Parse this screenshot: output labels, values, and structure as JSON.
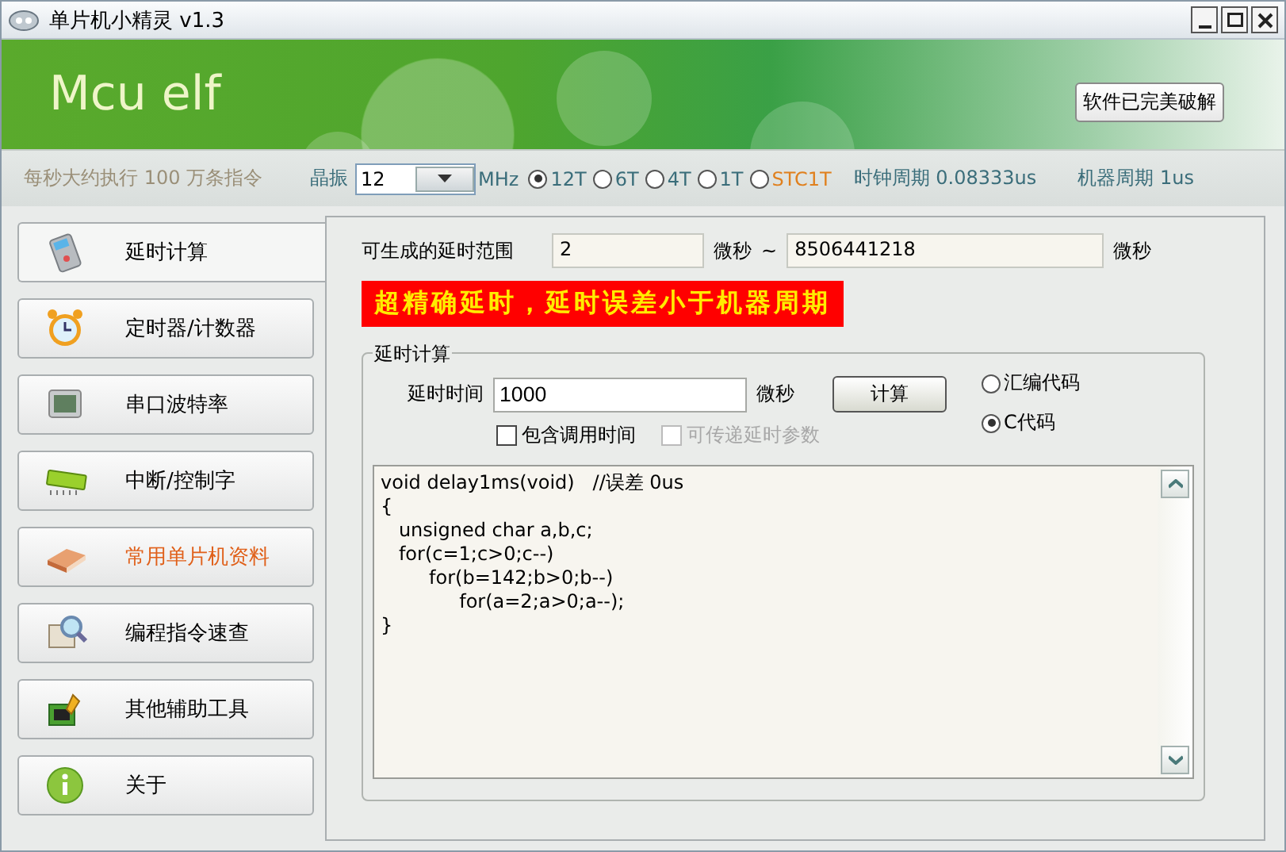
{
  "window": {
    "title": "单片机小精灵  v1.3"
  },
  "banner": {
    "logo": "Mcu elf",
    "button": "软件已完美破解"
  },
  "info_bar": {
    "speed": "每秒大约执行 100 万条指令",
    "crystal_label": "晶振",
    "crystal_value": "12",
    "crystal_unit": "MHz",
    "modes": [
      {
        "label": "12T",
        "selected": true,
        "highlighted": false
      },
      {
        "label": "6T",
        "selected": false,
        "highlighted": false
      },
      {
        "label": "4T",
        "selected": false,
        "highlighted": false
      },
      {
        "label": "1T",
        "selected": false,
        "highlighted": false
      },
      {
        "label": "STC1T",
        "selected": false,
        "highlighted": true
      }
    ],
    "clock_period": "时钟周期 0.08333us",
    "machine_period": "机器周期 1us"
  },
  "sidebar": {
    "items": [
      {
        "label": "延时计算",
        "selected": true,
        "highlighted": false
      },
      {
        "label": "定时器/计数器",
        "selected": false,
        "highlighted": false
      },
      {
        "label": "串口波特率",
        "selected": false,
        "highlighted": false
      },
      {
        "label": "中断/控制字",
        "selected": false,
        "highlighted": false
      },
      {
        "label": "常用单片机资料",
        "selected": false,
        "highlighted": true
      },
      {
        "label": "编程指令速查",
        "selected": false,
        "highlighted": false
      },
      {
        "label": "其他辅助工具",
        "selected": false,
        "highlighted": false
      },
      {
        "label": "关于",
        "selected": false,
        "highlighted": false
      }
    ]
  },
  "range": {
    "label": "可生成的延时范围",
    "min": "2",
    "min_unit": "微秒",
    "tilde": "~",
    "max": "8506441218",
    "max_unit": "微秒"
  },
  "banner_text": "超精确延时，延时误差小于机器周期",
  "group": {
    "title": "延时计算",
    "time_label": "延时时间",
    "time_value": "1000",
    "time_unit": "微秒",
    "calc_button": "计算",
    "code_types": [
      {
        "label": "汇编代码",
        "selected": false
      },
      {
        "label": "C代码",
        "selected": true
      }
    ],
    "checkboxes": [
      {
        "label": "包含调用时间",
        "checked": false,
        "disabled": false
      },
      {
        "label": "可传递延时参数",
        "checked": false,
        "disabled": true
      }
    ],
    "code": [
      "void delay1ms(void)   //误差 0us",
      "{",
      "   unsigned char a,b,c;",
      "   for(c=1;c>0;c--)",
      "        for(b=142;b>0;b--)",
      "             for(a=2;a>0;a--);",
      "}"
    ]
  }
}
